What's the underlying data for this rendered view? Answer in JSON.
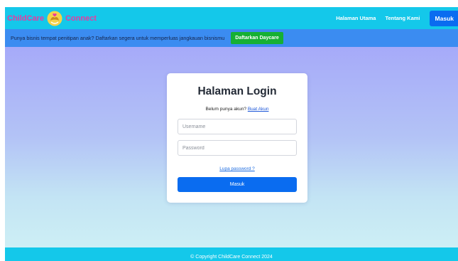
{
  "navbar": {
    "brand_left": "ChildCare",
    "brand_right": "Connect",
    "brand_icon": "hand-heart-icon",
    "links": [
      "Halaman Utama",
      "Tentang Kami"
    ],
    "login_button": "Masuk"
  },
  "promo": {
    "text": "Punya bisnis tempat penitipan anak? Daftarkan segera untuk memperluas jangkauan bisnismu",
    "button": "Daftarkan Daycare"
  },
  "login": {
    "title": "Halaman Login",
    "prompt": "Belum punya akun?",
    "register_link": "Buat Akun",
    "username_placeholder": "Username",
    "password_placeholder": "Password",
    "forgot_link": "Lupa password ?",
    "submit": "Masuk"
  },
  "footer": {
    "text": "© Copyright ChildCare Connect 2024"
  },
  "colors": {
    "navbar": "#14c8ea",
    "brand": "#e83aa0",
    "primary": "#0a6cf0",
    "promo_bar": "#3b8cf1",
    "promo_button": "#16b034"
  }
}
